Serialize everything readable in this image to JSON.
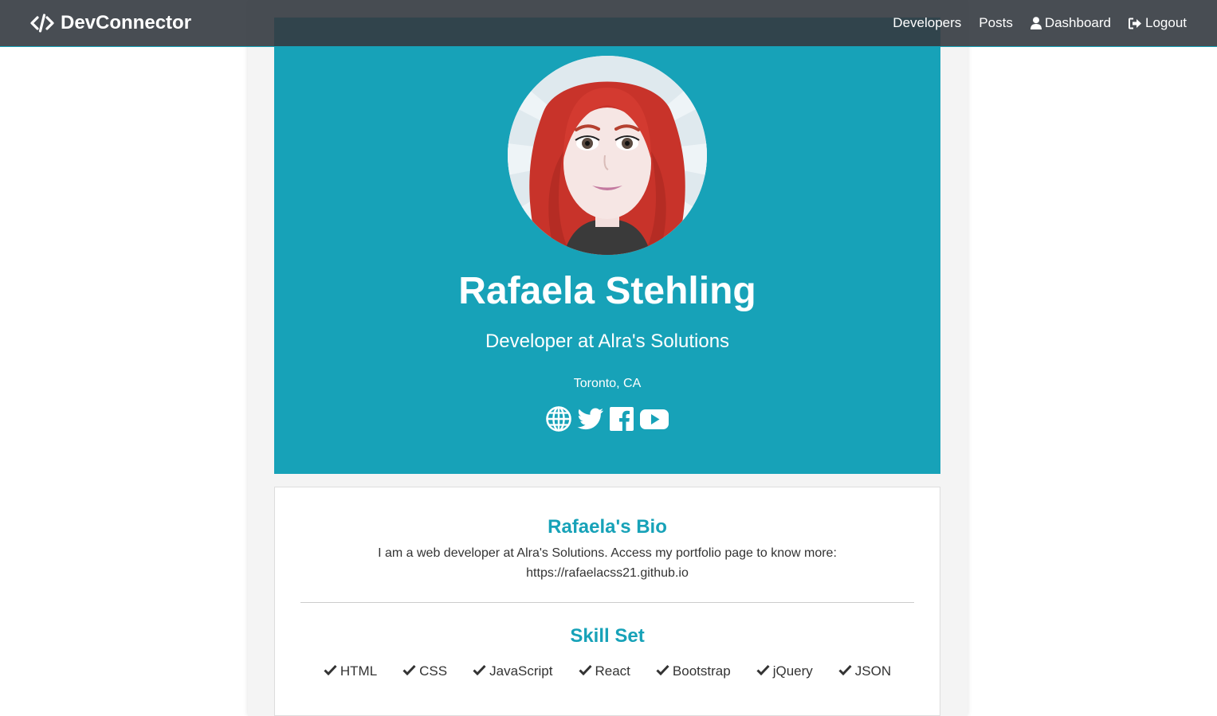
{
  "navbar": {
    "brand": "DevConnector",
    "links": [
      {
        "label": "Developers",
        "icon": ""
      },
      {
        "label": "Posts",
        "icon": ""
      },
      {
        "label": "Dashboard",
        "icon": "user-icon"
      },
      {
        "label": "Logout",
        "icon": "sign-out-icon"
      }
    ]
  },
  "profile": {
    "name": "Rafaela Stehling",
    "status": "Developer at Alra's Solutions",
    "location": "Toronto, CA",
    "social": [
      "globe-icon",
      "twitter-icon",
      "facebook-icon",
      "youtube-icon"
    ]
  },
  "about": {
    "bio_title": "Rafaela's Bio",
    "bio_text": "I am a web developer at Alra's Solutions. Access my portfolio page to know more: https://rafaelacss21.github.io",
    "skills_title": "Skill Set",
    "skills": [
      "HTML",
      "CSS",
      "JavaScript",
      "React",
      "Bootstrap",
      "jQuery",
      "JSON"
    ]
  },
  "colors": {
    "primary": "#17a2b8",
    "navbar": "#343a40",
    "hair": "#c8332a"
  }
}
